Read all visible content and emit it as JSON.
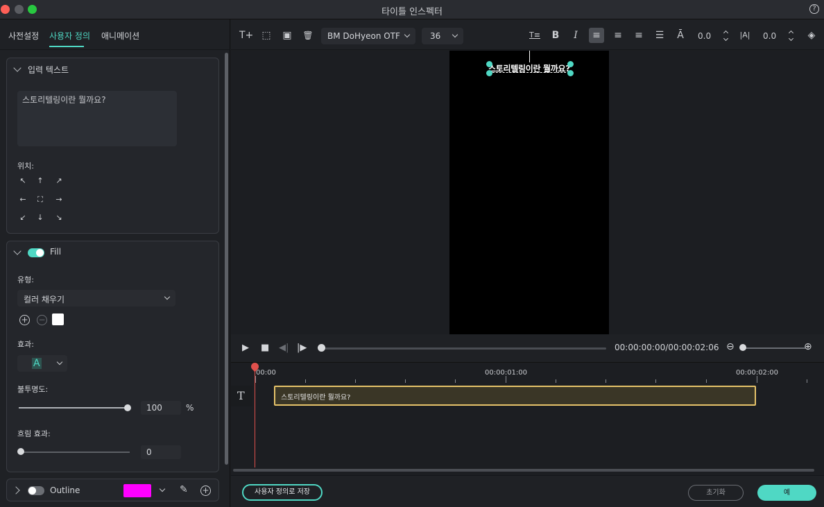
{
  "window": {
    "title": "타이틀 인스펙터",
    "help": "?"
  },
  "left": {
    "tabs": [
      "사전설정",
      "사용자 정의",
      "애니메이션"
    ],
    "active_tab": "사용자 정의",
    "input_section": {
      "title": "입력 텍스트",
      "text": "스토리텔링이란 뭘까요?",
      "position_label": "위치:",
      "arrows": [
        "↖",
        "↑",
        "↗",
        "←",
        "⛶",
        "→",
        "↙",
        "↓",
        "↘"
      ]
    },
    "fill_section": {
      "title": "Fill",
      "enabled": true,
      "type_label": "유형:",
      "type_value": "컬러 채우기",
      "swatch_color": "#ffffff",
      "effect_label": "효과:",
      "effect_value": "A",
      "opacity_label": "불투명도:",
      "opacity_value": "100",
      "opacity_unit": "%",
      "blur_label": "흐림 효과:",
      "blur_value": "0"
    },
    "outline_section": {
      "title": "Outline",
      "enabled": false,
      "color": "#ff00ff"
    }
  },
  "toolbar": {
    "font": "BM DoHyeon OTF",
    "size": "36",
    "spacing_value": "0.0",
    "kerning_value": "0.0",
    "icons": [
      "add-text-icon",
      "crop-icon",
      "image-icon",
      "replace-image-icon",
      "trash-icon",
      "text-style-icon",
      "bold-icon",
      "italic-icon",
      "align-left-icon",
      "align-center-icon",
      "align-right-icon",
      "justify-icon",
      "line-spacing-icon",
      "kerning-icon",
      "layers-icon"
    ]
  },
  "preview": {
    "caption": "스토리텔링이란 뭘까요?"
  },
  "playback": {
    "timecode": "00:00:00:00/00:00:02:06"
  },
  "timeline": {
    "labels": [
      "00:00",
      "00:00:01:00",
      "00:00:02:00"
    ],
    "track_icon": "T",
    "clip_text": "스토리텔링이란 뭘까요?"
  },
  "footer": {
    "save_custom": "사용자 정의로 저장",
    "reset": "초기화",
    "ok": "예"
  },
  "colors": {
    "accent": "#4fd8c4",
    "clip_border": "#e7c46a",
    "playhead": "#e0504c",
    "outline_color": "#ff00ff"
  }
}
